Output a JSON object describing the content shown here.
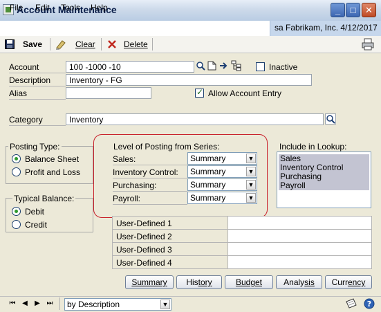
{
  "window": {
    "title": "Account Maintenance",
    "minimize_glyph": "_",
    "maximize_glyph": "□",
    "close_glyph": "✕"
  },
  "menu": {
    "items": [
      "File",
      "Edit",
      "Tools",
      "Help"
    ],
    "company_info": "sa  Fabrikam, Inc.  4/12/2017"
  },
  "toolbar": {
    "save_label": "Save",
    "clear_label": "Clear",
    "delete_label": "Delete"
  },
  "form": {
    "account_label": "Account",
    "account_value": "100 -1000 -10",
    "inactive_label": "Inactive",
    "description_label": "Description",
    "description_value": "Inventory - FG",
    "alias_label": "Alias",
    "alias_value": "",
    "allow_entry_label": "Allow Account Entry",
    "category_label": "Category",
    "category_value": "Inventory"
  },
  "posting_type": {
    "title": "Posting Type:",
    "options": [
      "Balance Sheet",
      "Profit and Loss"
    ],
    "selected": "Balance Sheet"
  },
  "typical_balance": {
    "title": "Typical Balance:",
    "options": [
      "Debit",
      "Credit"
    ],
    "selected": "Debit"
  },
  "level_of_posting": {
    "title": "Level of Posting from Series:",
    "rows": [
      {
        "label": "Sales:",
        "value": "Summary"
      },
      {
        "label": "Inventory Control:",
        "value": "Summary"
      },
      {
        "label": "Purchasing:",
        "value": "Summary"
      },
      {
        "label": "Payroll:",
        "value": "Summary"
      }
    ]
  },
  "include_in_lookup": {
    "title": "Include in Lookup:",
    "items": [
      "Sales",
      "Inventory Control",
      "Purchasing",
      "Payroll"
    ]
  },
  "user_defined": [
    {
      "label": "User-Defined 1",
      "value": ""
    },
    {
      "label": "User-Defined 2",
      "value": ""
    },
    {
      "label": "User-Defined 3",
      "value": ""
    },
    {
      "label": "User-Defined 4",
      "value": ""
    }
  ],
  "buttons": {
    "summary": [
      "",
      "Summary"
    ],
    "history": [
      "His",
      "tory"
    ],
    "budget": [
      "B",
      "udget"
    ],
    "analysis": [
      "Analy",
      "sis"
    ],
    "currency": [
      "Curr",
      "ency"
    ]
  },
  "status": {
    "sort_value": "by Description"
  },
  "colors": {
    "title_text": "#0b1f4a",
    "highlight_box": "#c8202a",
    "lookup_selection": "#c3c4d2"
  }
}
